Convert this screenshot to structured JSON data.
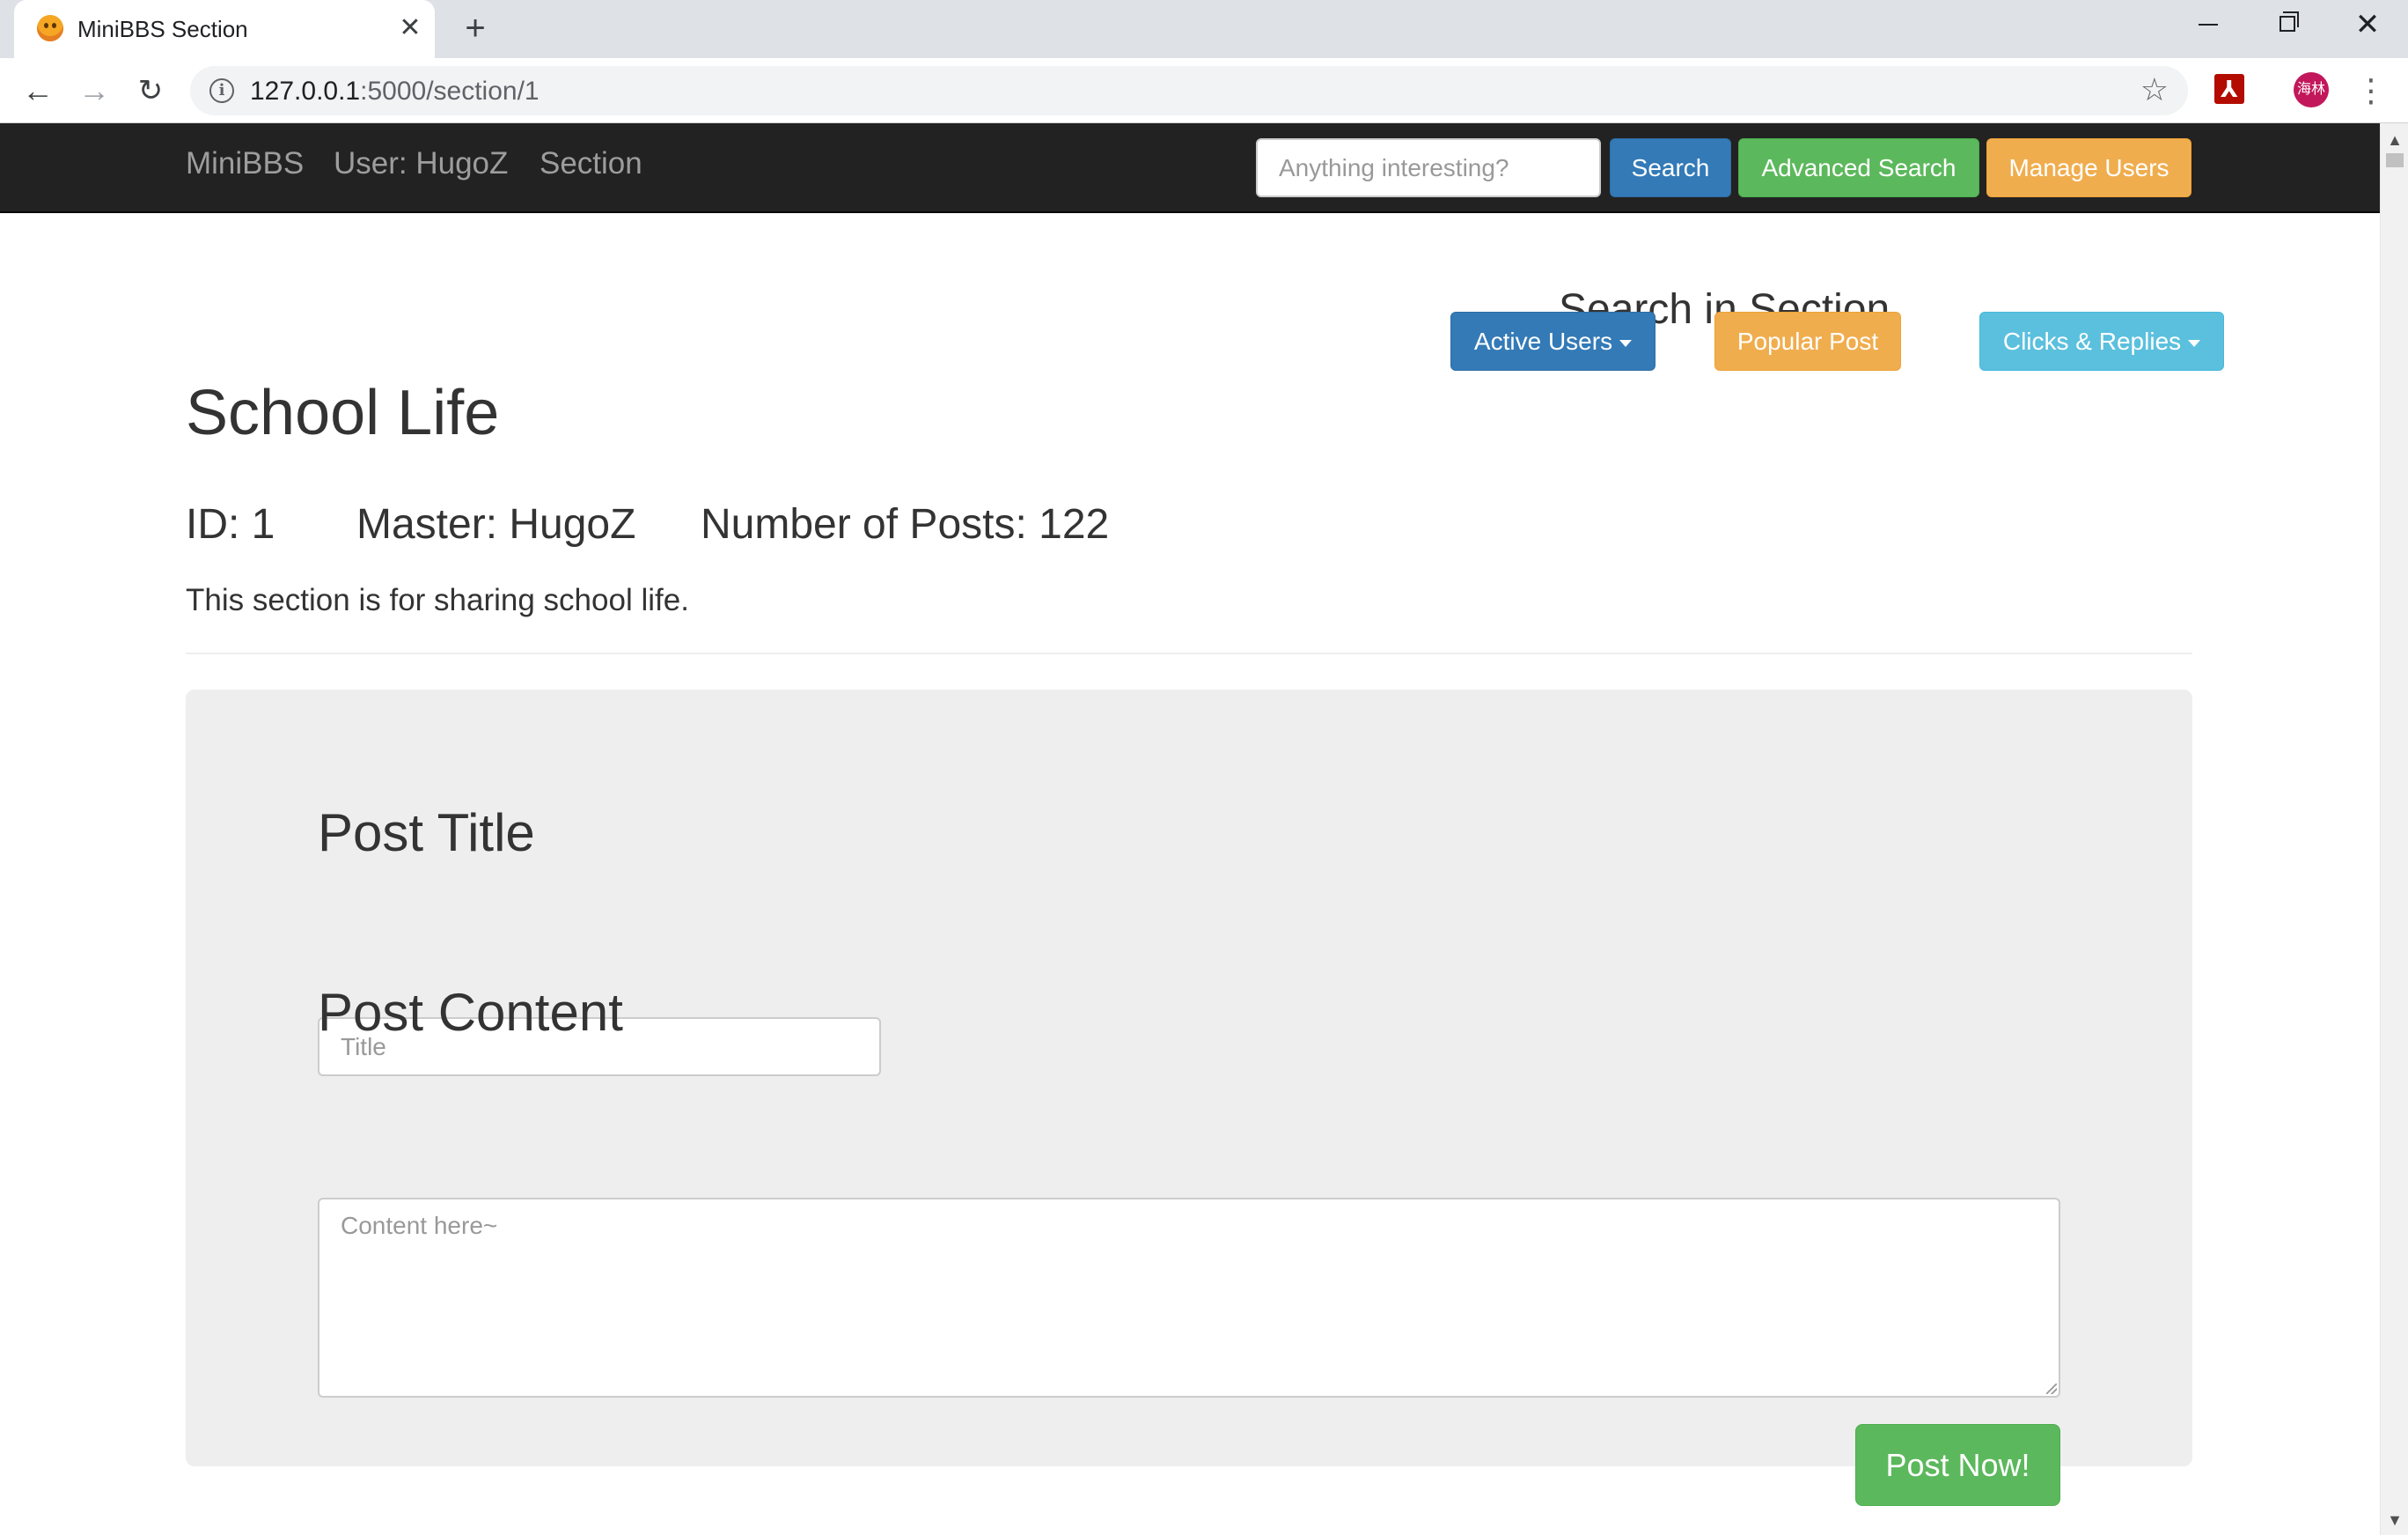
{
  "browser": {
    "tab_title": "MiniBBS Section",
    "tab_close": "✕",
    "new_tab": "+",
    "url_host": "127.0.0.1",
    "url_path": ":5000/section/1",
    "win_close": "✕",
    "profile_initials": "海林",
    "menu": "⋮",
    "back": "←",
    "forward": "→",
    "reload": "↻",
    "star": "☆"
  },
  "navbar": {
    "brand": "MiniBBS",
    "user": "User: HugoZ",
    "section": "Section",
    "search_placeholder": "Anything interesting?",
    "search_button": "Search",
    "advanced_search_button": "Advanced Search",
    "manage_users_button": "Manage Users"
  },
  "section_tools": {
    "heading": "Search in Section",
    "active_users": "Active Users",
    "popular_post": "Popular Post",
    "clicks_replies": "Clicks & Replies"
  },
  "section": {
    "title": "School Life",
    "id": "ID: 1",
    "master": "Master: HugoZ",
    "posts": "Number of Posts: 122",
    "description": "This section is for sharing school life."
  },
  "post_form": {
    "title_heading": "Post Title",
    "title_placeholder": "Title",
    "content_heading": "Post Content",
    "content_placeholder": "Content here~",
    "submit": "Post Now!"
  },
  "colors": {
    "navbar_bg": "#222222",
    "primary": "#337ab7",
    "success": "#5cb85c",
    "warning": "#f0ad4e",
    "info": "#5bc0de",
    "well_bg": "#eeeeee"
  }
}
